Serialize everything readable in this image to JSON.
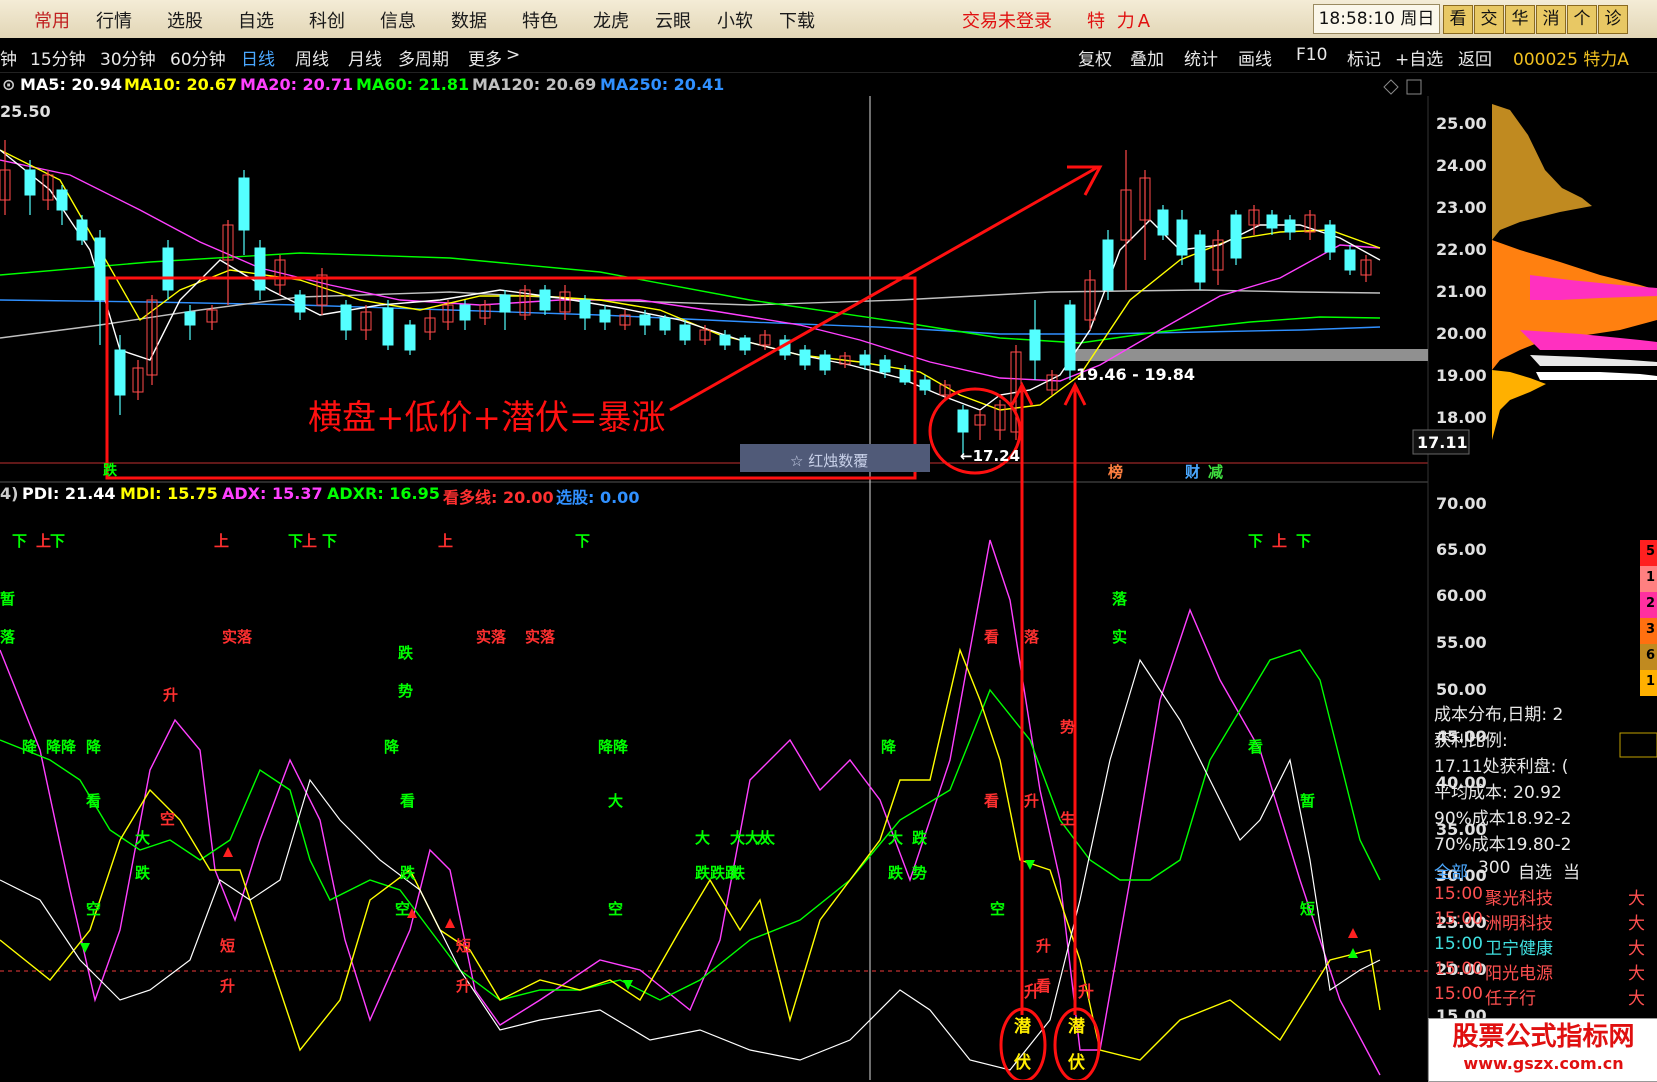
{
  "menu": [
    "常用",
    "行情",
    "选股",
    "自选",
    "科创",
    "信息",
    "数据",
    "特色",
    "龙虎",
    "云眼",
    "小软",
    "下载"
  ],
  "login_status": "交易未登录",
  "stock_name": "特 力A",
  "clock": "18:58:10 周日",
  "quick_buttons": [
    "看",
    "交",
    "华",
    "消",
    "个",
    "诊"
  ],
  "periods": [
    "钟",
    "15分钟",
    "30分钟",
    "60分钟",
    "日线",
    "周线",
    "月线",
    "多周期",
    "更多"
  ],
  "active_period": "日线",
  "chart_tools": [
    "复权",
    "叠加",
    "统计",
    "画线",
    "F10",
    "标记",
    "+自选",
    "返回"
  ],
  "stock_code_name": "000025 特力A",
  "ma": {
    "ma5": "MA5: 20.94",
    "ma10": "MA10: 20.67",
    "ma20": "MA20: 20.71",
    "ma60": "MA60: 21.81",
    "ma120": "MA120: 20.69",
    "ma250": "MA250: 20.41",
    "colors": {
      "ma5": "#ffffff",
      "ma10": "#ffff00",
      "ma20": "#ff40ff",
      "ma60": "#00ff00",
      "ma120": "#c0c0c0",
      "ma250": "#3090ff"
    }
  },
  "top_price_label": "25.50",
  "price_axis": [
    "25.00",
    "24.00",
    "23.00",
    "22.00",
    "21.00",
    "20.00",
    "19.00",
    "18.00"
  ],
  "current_price_box": "17.11",
  "low_label": "←17.24",
  "range_label": "19.46 - 19.84",
  "hint_bar": "☆ 红烛数覆",
  "annotation_text": "横盘+低价+潜伏=暴涨",
  "indicator": {
    "period": "4)",
    "pdi": "PDI: 21.44",
    "mdi": "MDI: 15.75",
    "adx": "ADX: 15.37",
    "adxr": "ADXR: 16.95",
    "kdx": "看多线: 20.00",
    "xg": "选股: 0.00"
  },
  "indicator_axis": [
    "70.00",
    "65.00",
    "60.00",
    "55.00",
    "50.00",
    "45.00",
    "40.00",
    "35.00",
    "30.00",
    "25.00",
    "20.00",
    "15.00"
  ],
  "signals": [
    "下",
    "上",
    "下",
    "上",
    "下",
    "上",
    "下",
    "上",
    "下",
    "下",
    "上",
    "下",
    "暂",
    "落",
    "实落",
    "实落",
    "实落",
    "跌",
    "势",
    "升",
    "降",
    "降降",
    "降",
    "降",
    "降降",
    "降",
    "看",
    "看",
    "看",
    "大",
    "大",
    "大",
    "大大大",
    "大",
    "大",
    "跌",
    "跌",
    "跌",
    "跌跌跌",
    "跌",
    "跌",
    "势",
    "空",
    "空",
    "空",
    "空",
    "空",
    "短",
    "短",
    "短",
    "升",
    "升",
    "升",
    "看",
    "暂",
    "落",
    "实",
    "落",
    "看",
    "看",
    "升",
    "势",
    "生"
  ],
  "signal_labels": {
    "qianfu1": "潜伏",
    "qianfu2": "潜伏",
    "qian": "潜",
    "fu": "伏",
    "rise": "升"
  },
  "bottom_signs": [
    "榜",
    "财",
    "减",
    "跌"
  ],
  "right_panel": {
    "cost_date": "成本分布,日期: 2",
    "profit_ratio": "获利比例:",
    "profit_at": "17.11处获利盘: (",
    "avg_cost": "平均成本: 20.92",
    "cost90": "90%成本18.92-2",
    "cost70": "70%成本19.80-2",
    "tabs": [
      "全部",
      "300",
      "自选",
      "当"
    ],
    "stocks": [
      {
        "time": "15:00",
        "name": "聚光科技",
        "flag": "大",
        "color": "#ff5050"
      },
      {
        "time": "15:00",
        "name": "洲明科技",
        "flag": "大",
        "color": "#ff5050"
      },
      {
        "time": "15:00",
        "name": "卫宁健康",
        "flag": "大",
        "color": "#40e0e0"
      },
      {
        "time": "15:00",
        "name": "阳光电源",
        "flag": "大",
        "color": "#ff5050"
      },
      {
        "time": "15:00",
        "name": "任子行",
        "flag": "大",
        "color": "#ff5050"
      }
    ],
    "legend_bits": [
      "5",
      "1",
      "2",
      "3",
      "6",
      "1"
    ]
  },
  "watermark": {
    "title": "股票公式指标网",
    "url": "www.gszx.com.cn"
  }
}
